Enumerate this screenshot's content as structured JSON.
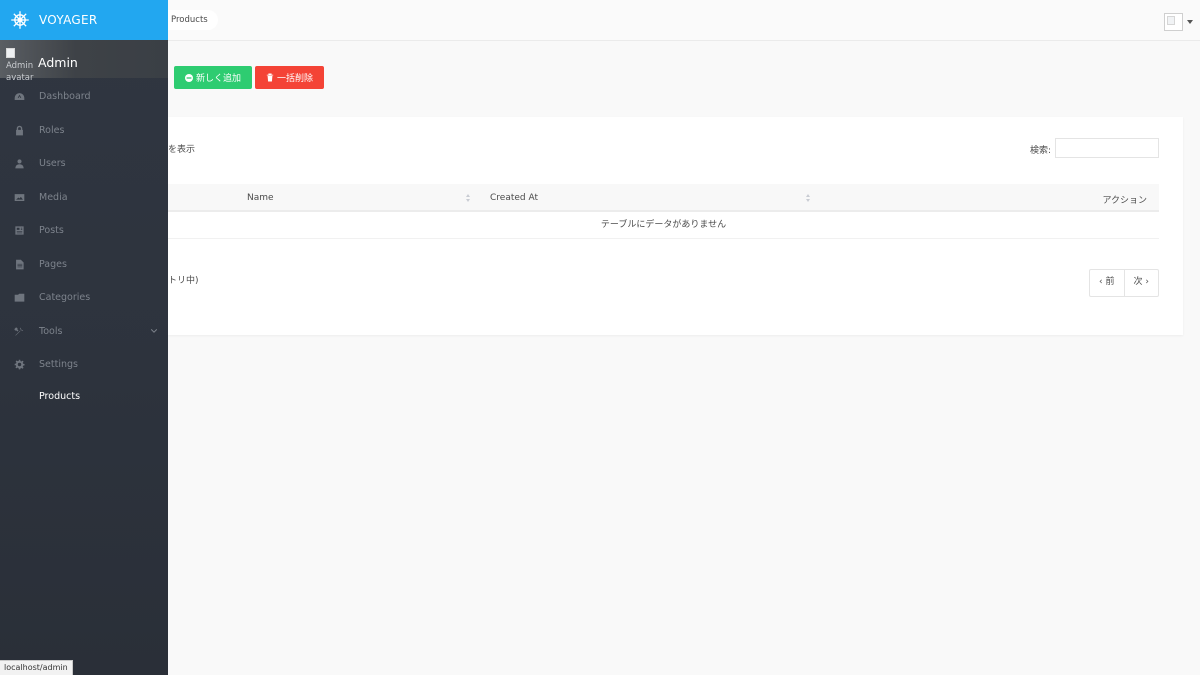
{
  "brand": {
    "name": "VOYAGER"
  },
  "user": {
    "name": "Admin",
    "avatar_alt_line1": "Admin",
    "avatar_alt_line2": "avatar"
  },
  "sidebar": {
    "items": [
      {
        "label": "Dashboard",
        "icon": "dashboard-icon"
      },
      {
        "label": "Roles",
        "icon": "lock-icon"
      },
      {
        "label": "Users",
        "icon": "person-icon"
      },
      {
        "label": "Media",
        "icon": "image-icon"
      },
      {
        "label": "Posts",
        "icon": "news-icon"
      },
      {
        "label": "Pages",
        "icon": "file-icon"
      },
      {
        "label": "Categories",
        "icon": "folder-icon"
      },
      {
        "label": "Tools",
        "icon": "tools-icon"
      },
      {
        "label": "Settings",
        "icon": "gear-icon"
      },
      {
        "label": "Products",
        "icon": ""
      }
    ],
    "active": "Products"
  },
  "breadcrumb": {
    "current": "Products"
  },
  "actions": {
    "add_label": "新しく追加",
    "bulk_delete_label": "一括削除"
  },
  "table": {
    "length_label": "を表示",
    "search_label": "検索:",
    "search_value": "",
    "columns": [
      "Name",
      "Created At",
      "アクション"
    ],
    "empty_message": "テーブルにデータがありません",
    "info": "トリ中)",
    "pagination": {
      "prev": "前",
      "next": "次"
    }
  },
  "status_bar": {
    "url": "localhost/admin"
  },
  "colors": {
    "brand": "#22a7f0",
    "add": "#2ecc71",
    "delete": "#f44336",
    "sidebar": "#2d333d"
  }
}
